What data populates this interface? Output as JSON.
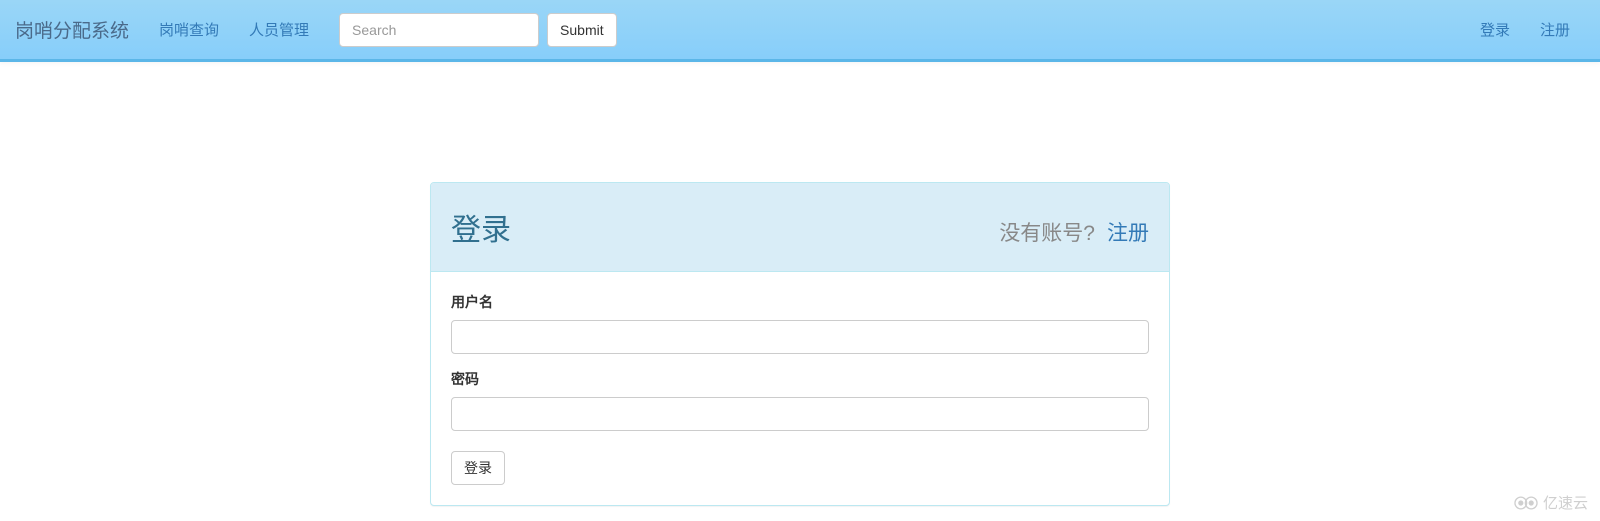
{
  "navbar": {
    "brand": "岗哨分配系统",
    "links": [
      "岗哨查询",
      "人员管理"
    ],
    "search_placeholder": "Search",
    "submit_label": "Submit",
    "right_links": [
      "登录",
      "注册"
    ]
  },
  "panel": {
    "title": "登录",
    "no_account_text": "没有账号?",
    "register_link": "注册",
    "username_label": "用户名",
    "password_label": "密码",
    "login_button": "登录"
  },
  "watermark": "亿速云"
}
